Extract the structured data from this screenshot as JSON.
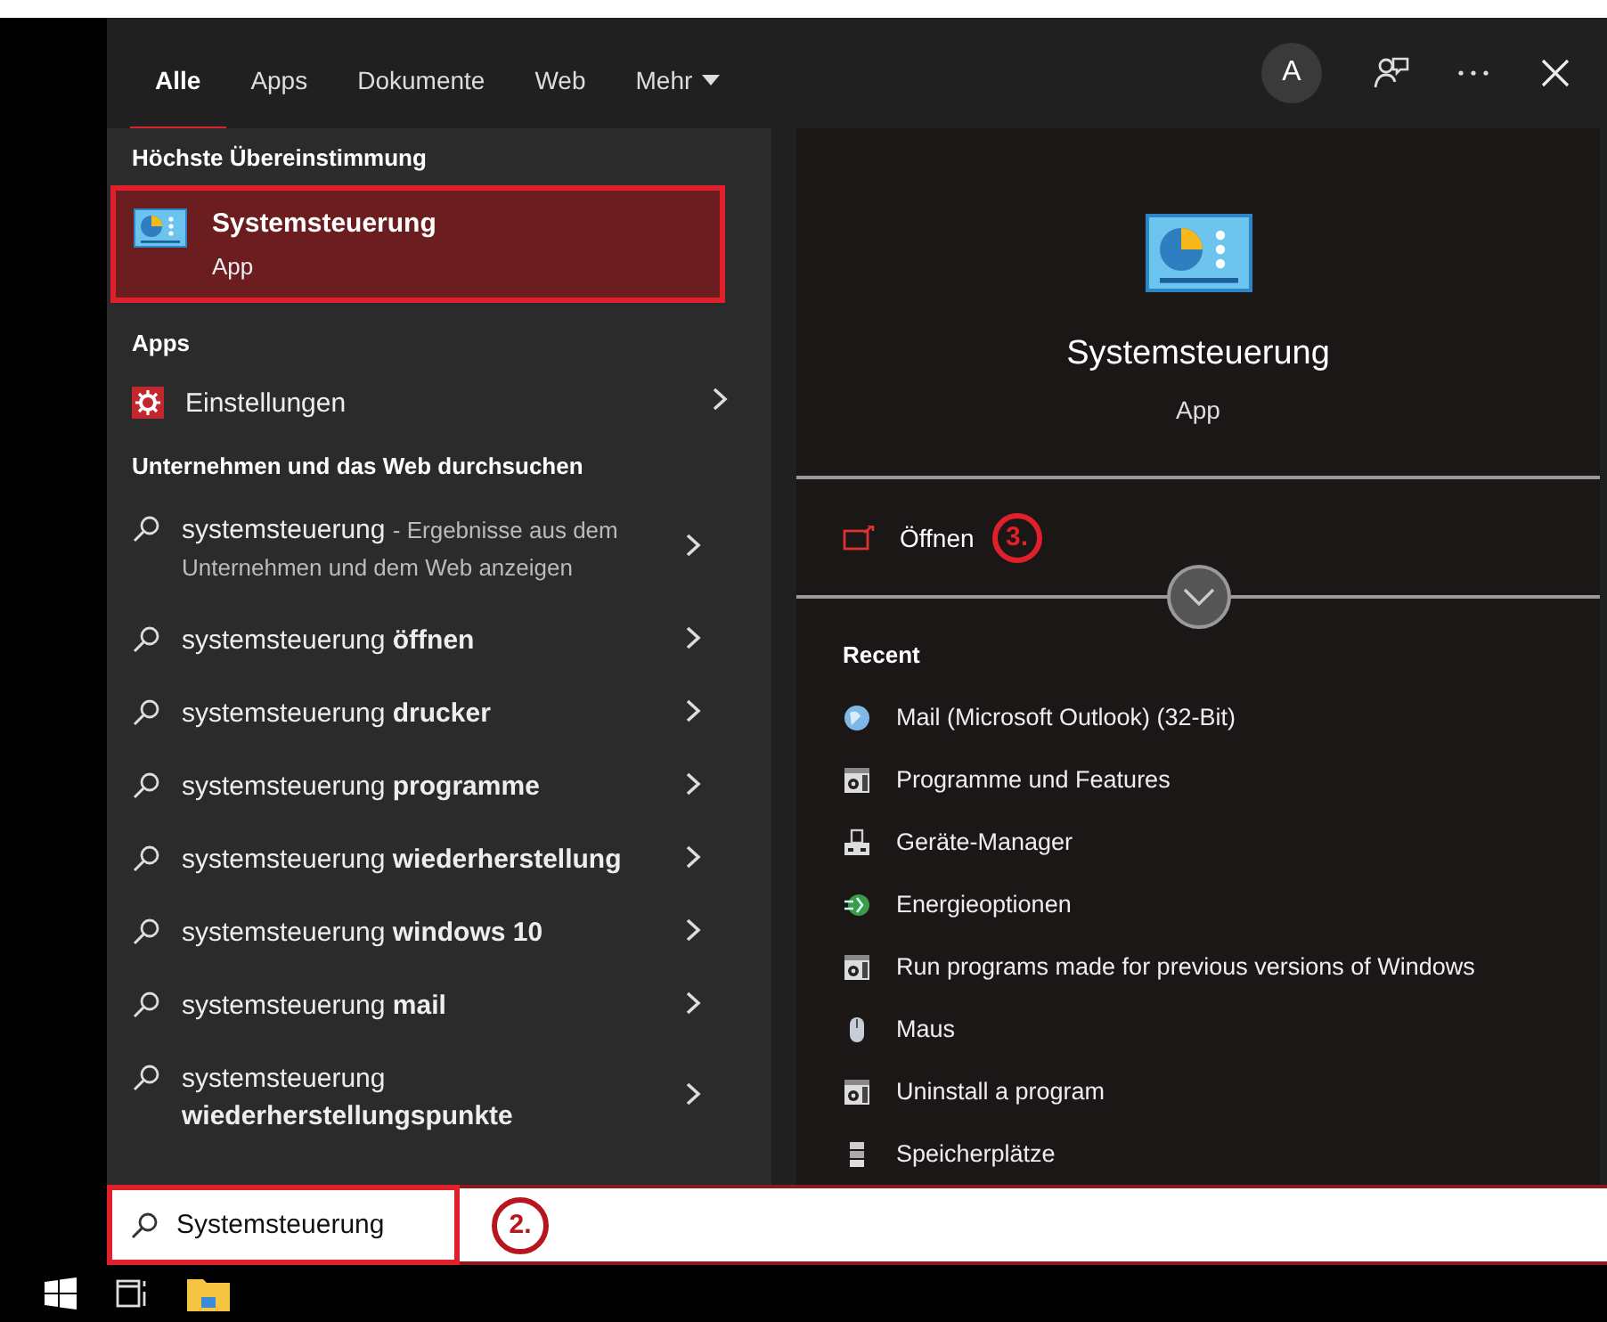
{
  "tabs": [
    {
      "label": "Alle",
      "selected": true
    },
    {
      "label": "Apps",
      "selected": false
    },
    {
      "label": "Dokumente",
      "selected": false
    },
    {
      "label": "Web",
      "selected": false
    },
    {
      "label": "Mehr",
      "selected": false,
      "dropdown": true
    }
  ],
  "header": {
    "avatar": "A"
  },
  "best_match": {
    "heading": "Höchste Übereinstimmung",
    "title": "Systemsteuerung",
    "subtitle": "App",
    "selected": true
  },
  "apps": {
    "heading": "Apps",
    "items": [
      {
        "label": "Einstellungen"
      }
    ]
  },
  "web": {
    "heading": "Unternehmen und das Web durchsuchen",
    "items": [
      {
        "text": "systemsteuerung",
        "note": "- Ergebnisse aus dem Unternehmen und dem Web anzeigen"
      },
      {
        "text": "systemsteuerung **öffnen**"
      },
      {
        "text": "systemsteuerung **drucker**"
      },
      {
        "text": "systemsteuerung **programme**"
      },
      {
        "text": "systemsteuerung **wiederherstellung**"
      },
      {
        "text": "systemsteuerung **windows 10**"
      },
      {
        "text": "systemsteuerung **mail**"
      },
      {
        "text": "systemsteuerung **wiederherstellungspunkte**"
      }
    ]
  },
  "preview": {
    "title": "Systemsteuerung",
    "subtitle": "App",
    "open_label": "Öffnen",
    "open_step": "3.",
    "recent_heading": "Recent",
    "recent": [
      {
        "label": "Mail (Microsoft Outlook) (32-Bit)",
        "kind": "mail"
      },
      {
        "label": "Programme und Features",
        "kind": "panel"
      },
      {
        "label": "Geräte-Manager",
        "kind": "device"
      },
      {
        "label": "Energieoptionen",
        "kind": "power"
      },
      {
        "label": "Run programs made for previous versions of Windows",
        "kind": "panel"
      },
      {
        "label": "Maus",
        "kind": "mouse"
      },
      {
        "label": "Uninstall a program",
        "kind": "panel"
      },
      {
        "label": "Speicherplätze",
        "kind": "storage"
      }
    ]
  },
  "search": {
    "value": "Systemsteuerung",
    "step": "2."
  }
}
